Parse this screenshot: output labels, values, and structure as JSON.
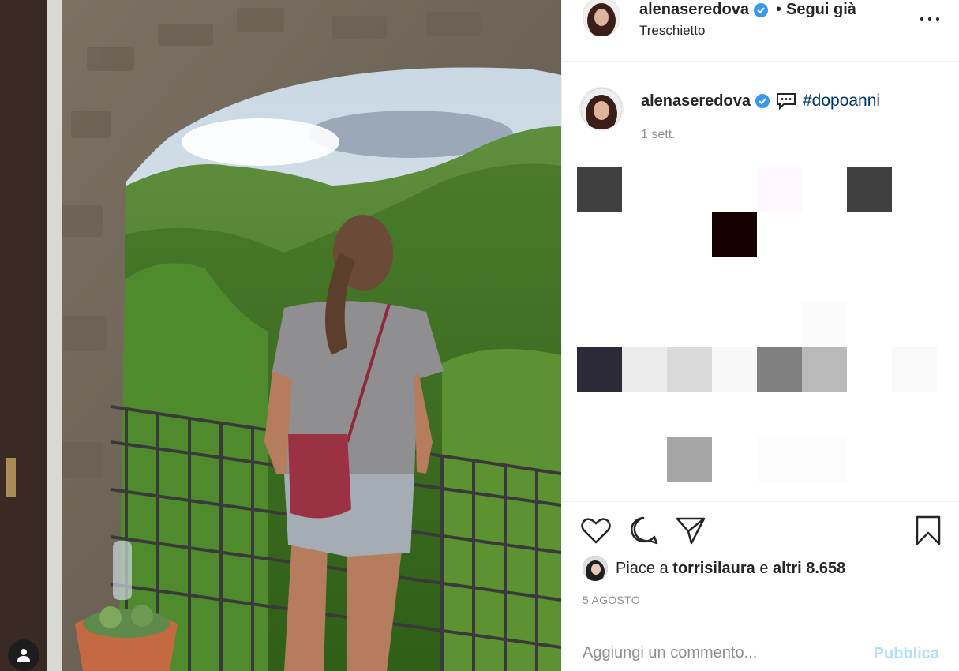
{
  "post_header": {
    "username": "alenaseredova",
    "separator": "•",
    "follow_status": "Segui già",
    "location": "Treschietto"
  },
  "caption": {
    "username": "alenaseredova",
    "hashtag": "#dopoanni",
    "time_ago": "1 sett."
  },
  "caption_pixel_blocks": [
    {
      "color": "#404040"
    },
    {
      "color": "#fff7fd"
    },
    {
      "color": "#404040"
    },
    {
      "color": "#160000"
    },
    {
      "color": "#fbfbfb"
    },
    {
      "color": "#2c2a38"
    },
    {
      "color": "#ececec"
    },
    {
      "color": "#dadada"
    },
    {
      "color": "#f8f8f8"
    },
    {
      "color": "#808080"
    },
    {
      "color": "#b9b9b9"
    },
    {
      "color": "#f9f9f9"
    },
    {
      "color": "#a6a6a6"
    },
    {
      "color": "#fcfcfc"
    },
    {
      "color": "#fcfcfc"
    }
  ],
  "actions": {
    "like_icon": "heart-icon",
    "comment_icon": "comment-icon",
    "share_icon": "paper-plane-icon",
    "save_icon": "bookmark-icon"
  },
  "likes": {
    "prefix": "Piace a",
    "liked_by": "torrisilaura",
    "conjunction": "e",
    "others": "altri 8.658"
  },
  "post_date": "5 AGOSTO",
  "comment": {
    "placeholder": "Aggiungi un commento...",
    "publish_label": "Pubblica"
  },
  "colors": {
    "link": "#00376b",
    "muted": "#8e8e8e",
    "verified": "#3897f0",
    "publish_disabled": "#b2dffc"
  }
}
